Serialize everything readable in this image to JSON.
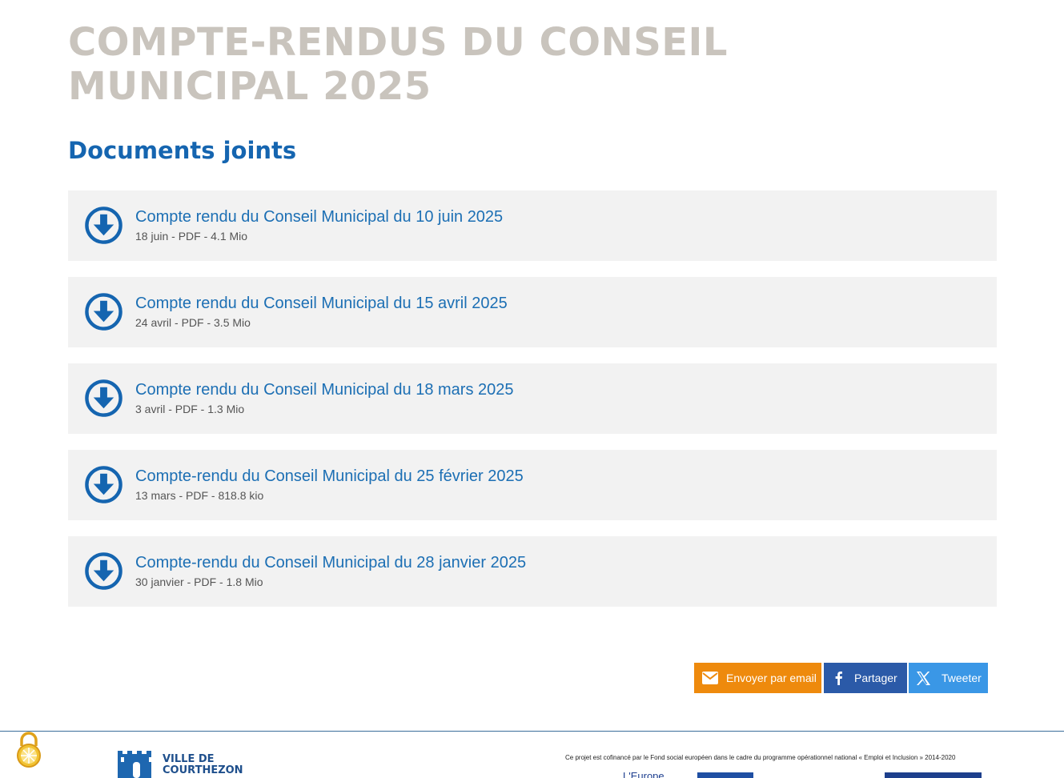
{
  "page": {
    "title": "COMPTE-RENDUS DU CONSEIL MUNICIPAL 2025",
    "section_title": "Documents joints"
  },
  "documents": [
    {
      "title": "Compte rendu du Conseil Municipal du 10 juin 2025",
      "meta": "18 juin - PDF - 4.1 Mio"
    },
    {
      "title": "Compte rendu du Conseil Municipal du 15 avril 2025",
      "meta": "24 avril - PDF - 3.5 Mio"
    },
    {
      "title": "Compte rendu du Conseil Municipal du 18 mars 2025",
      "meta": "3 avril - PDF - 1.3 Mio"
    },
    {
      "title": "Compte-rendu du Conseil Municipal du 25 février 2025",
      "meta": "13 mars - PDF - 818.8 kio"
    },
    {
      "title": "Compte-rendu du Conseil Municipal du 28 janvier 2025",
      "meta": "30 janvier - PDF - 1.8 Mio"
    }
  ],
  "share": {
    "email_label": "Envoyer par email",
    "facebook_label": "Partager",
    "x_label": "Tweeter"
  },
  "footer": {
    "logo_line1": "VILLE DE",
    "logo_line2": "COURTHEZON",
    "cofinance_text": "Ce projet est cofinancé par le Fond social européen dans le cadre du programme opérationnel national « Emploi et Inclusion » 2014-2020",
    "europe_text": "L'Europe"
  },
  "colors": {
    "accent": "#1565b0",
    "title_gray": "#c9c4bd",
    "email": "#ee8a0d",
    "facebook": "#2b5aa8",
    "x": "#3a97e6"
  }
}
